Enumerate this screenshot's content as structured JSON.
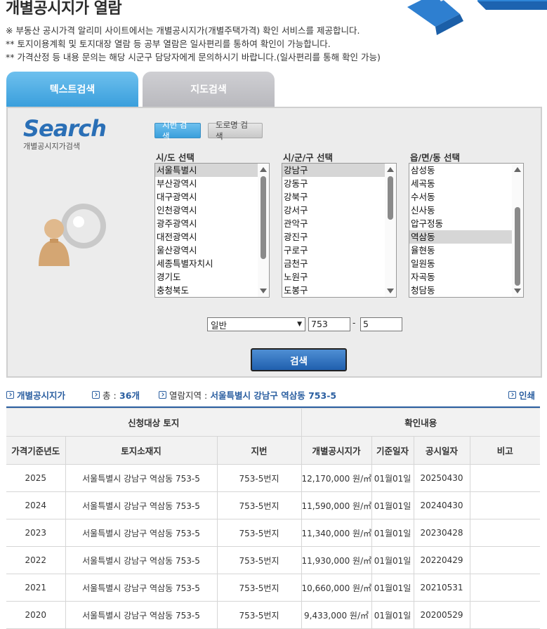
{
  "page_title": "개별공시지가 열람",
  "notices": [
    "※ 부동산 공시가격 알리미 사이트에서는 개별공시지가(개별주택가격) 확인 서비스를 제공합니다.",
    "** 토지이용계획 및 토지대장 열람 등 공부 열람은 일사편리를 통하여 확인이 가능합니다.",
    "** 가격산정 등 내용 문의는 해당 시군구 담당자에게 문의하시기 바랍니다.(일사편리를 통해 확인 가능)"
  ],
  "tabs": [
    {
      "label": "텍스트검색",
      "active": true
    },
    {
      "label": "지도검색",
      "active": false
    }
  ],
  "panel": {
    "logo_title": "Search",
    "logo_sub": "개별공시지가검색",
    "btn_jibun": "지번 검색",
    "btn_road": "도로명 검색",
    "label_sido": "시/도 선택",
    "label_sigungu": "시/군/구 선택",
    "label_dong": "읍/면/동 선택",
    "sido_options": [
      "서울특별시",
      "부산광역시",
      "대구광역시",
      "인천광역시",
      "광주광역시",
      "대전광역시",
      "울산광역시",
      "세종특별자치시",
      "경기도",
      "충청북도"
    ],
    "sido_selected_index": 0,
    "sigungu_options": [
      "강남구",
      "강동구",
      "강북구",
      "강서구",
      "관악구",
      "광진구",
      "구로구",
      "금천구",
      "노원구",
      "도봉구"
    ],
    "sigungu_selected_index": 0,
    "dong_options": [
      "삼성동",
      "세곡동",
      "수서동",
      "신사동",
      "압구정동",
      "역삼동",
      "율현동",
      "일원동",
      "자곡동",
      "청담동"
    ],
    "dong_selected_index": 5,
    "land_type": "일반",
    "bonbun": "753",
    "bubun": "5",
    "dash": "-",
    "search_button": "검색"
  },
  "info": {
    "menu_label": "개별공시지가",
    "total_label": "총 :",
    "total_value": "36개",
    "area_label": "열람지역 :",
    "area_value": "서울특별시 강남구 역삼동 753-5",
    "print_label": "인쇄"
  },
  "table": {
    "group_left": "신청대상 토지",
    "group_right": "확인내용",
    "columns": [
      "가격기준년도",
      "토지소재지",
      "지번",
      "개별공시지가",
      "기준일자",
      "공시일자",
      "비고"
    ],
    "rows": [
      [
        "2025",
        "서울특별시 강남구 역삼동 753-5",
        "753-5번지",
        "12,170,000 원/㎡",
        "01월01일",
        "20250430",
        ""
      ],
      [
        "2024",
        "서울특별시 강남구 역삼동 753-5",
        "753-5번지",
        "11,590,000 원/㎡",
        "01월01일",
        "20240430",
        ""
      ],
      [
        "2023",
        "서울특별시 강남구 역삼동 753-5",
        "753-5번지",
        "11,340,000 원/㎡",
        "01월01일",
        "20230428",
        ""
      ],
      [
        "2022",
        "서울특별시 강남구 역삼동 753-5",
        "753-5번지",
        "11,930,000 원/㎡",
        "01월01일",
        "20220429",
        ""
      ],
      [
        "2021",
        "서울특별시 강남구 역삼동 753-5",
        "753-5번지",
        "10,660,000 원/㎡",
        "01월01일",
        "20210531",
        ""
      ],
      [
        "2020",
        "서울특별시 강남구 역삼동 753-5",
        "753-5번지",
        "9,433,000 원/㎡",
        "01월01일",
        "20200529",
        ""
      ]
    ]
  },
  "colors": {
    "accent": "#3a9fdc",
    "link_blue": "#2a5ea0",
    "panel_bg": "#ececec"
  }
}
